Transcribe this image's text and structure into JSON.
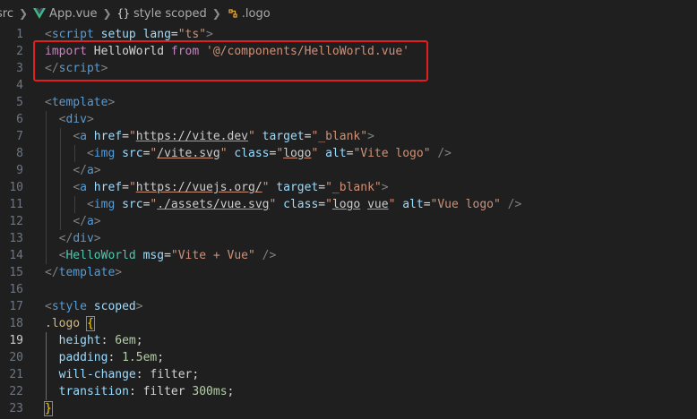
{
  "breadcrumb": {
    "folder": "src",
    "file": "App.vue",
    "section": "style scoped",
    "symbol": ".logo"
  },
  "editor": {
    "active_line": 19,
    "lines": [
      {
        "n": "1",
        "tokens": [
          [
            "tag",
            "<"
          ],
          [
            "tname",
            "script"
          ],
          [
            "attr",
            " setup"
          ],
          [
            "attr",
            " lang"
          ],
          [
            "plain",
            "="
          ],
          [
            "str",
            "\"ts\""
          ],
          [
            "tag",
            ">"
          ]
        ]
      },
      {
        "n": "2",
        "tokens": [
          [
            "kw",
            "import"
          ],
          [
            "plain",
            " HelloWorld "
          ],
          [
            "kw",
            "from"
          ],
          [
            "plain",
            " "
          ],
          [
            "str",
            "'@/components/HelloWorld.vue'"
          ]
        ]
      },
      {
        "n": "3",
        "tokens": [
          [
            "tag",
            "</"
          ],
          [
            "tname",
            "script"
          ],
          [
            "tag",
            ">"
          ]
        ]
      },
      {
        "n": "4",
        "tokens": []
      },
      {
        "n": "5",
        "tokens": [
          [
            "tag",
            "<"
          ],
          [
            "tname",
            "template"
          ],
          [
            "tag",
            ">"
          ]
        ]
      },
      {
        "n": "6",
        "tokens": [
          [
            "plain",
            "  "
          ],
          [
            "tag",
            "<"
          ],
          [
            "tname",
            "div"
          ],
          [
            "tag",
            ">"
          ]
        ]
      },
      {
        "n": "7",
        "tokens": [
          [
            "plain",
            "    "
          ],
          [
            "tag",
            "<"
          ],
          [
            "tname",
            "a"
          ],
          [
            "attr",
            " href"
          ],
          [
            "plain",
            "="
          ],
          [
            "str",
            "\""
          ],
          [
            "ul",
            "https://vite.dev"
          ],
          [
            "str",
            "\""
          ],
          [
            "attr",
            " target"
          ],
          [
            "plain",
            "="
          ],
          [
            "str",
            "\"_blank\""
          ],
          [
            "tag",
            ">"
          ]
        ]
      },
      {
        "n": "8",
        "tokens": [
          [
            "plain",
            "      "
          ],
          [
            "tag",
            "<"
          ],
          [
            "tname",
            "img"
          ],
          [
            "attr",
            " src"
          ],
          [
            "plain",
            "="
          ],
          [
            "str",
            "\""
          ],
          [
            "ul",
            "/vite.svg"
          ],
          [
            "str",
            "\""
          ],
          [
            "attr",
            " class"
          ],
          [
            "plain",
            "="
          ],
          [
            "str",
            "\""
          ],
          [
            "ul",
            "logo"
          ],
          [
            "str",
            "\""
          ],
          [
            "attr",
            " alt"
          ],
          [
            "plain",
            "="
          ],
          [
            "str",
            "\"Vite logo\""
          ],
          [
            "tag",
            " />"
          ]
        ]
      },
      {
        "n": "9",
        "tokens": [
          [
            "plain",
            "    "
          ],
          [
            "tag",
            "</"
          ],
          [
            "tname",
            "a"
          ],
          [
            "tag",
            ">"
          ]
        ]
      },
      {
        "n": "10",
        "tokens": [
          [
            "plain",
            "    "
          ],
          [
            "tag",
            "<"
          ],
          [
            "tname",
            "a"
          ],
          [
            "attr",
            " href"
          ],
          [
            "plain",
            "="
          ],
          [
            "str",
            "\""
          ],
          [
            "ul",
            "https://vuejs.org/"
          ],
          [
            "str",
            "\""
          ],
          [
            "attr",
            " target"
          ],
          [
            "plain",
            "="
          ],
          [
            "str",
            "\"_blank\""
          ],
          [
            "tag",
            ">"
          ]
        ]
      },
      {
        "n": "11",
        "tokens": [
          [
            "plain",
            "      "
          ],
          [
            "tag",
            "<"
          ],
          [
            "tname",
            "img"
          ],
          [
            "attr",
            " src"
          ],
          [
            "plain",
            "="
          ],
          [
            "str",
            "\""
          ],
          [
            "ul",
            "./assets/vue.svg"
          ],
          [
            "str",
            "\""
          ],
          [
            "attr",
            " class"
          ],
          [
            "plain",
            "="
          ],
          [
            "str",
            "\""
          ],
          [
            "ul",
            "logo"
          ],
          [
            "str",
            " "
          ],
          [
            "ul",
            "vue"
          ],
          [
            "str",
            "\""
          ],
          [
            "attr",
            " alt"
          ],
          [
            "plain",
            "="
          ],
          [
            "str",
            "\"Vue logo\""
          ],
          [
            "tag",
            " />"
          ]
        ]
      },
      {
        "n": "12",
        "tokens": [
          [
            "plain",
            "    "
          ],
          [
            "tag",
            "</"
          ],
          [
            "tname",
            "a"
          ],
          [
            "tag",
            ">"
          ]
        ]
      },
      {
        "n": "13",
        "tokens": [
          [
            "plain",
            "  "
          ],
          [
            "tag",
            "</"
          ],
          [
            "tname",
            "div"
          ],
          [
            "tag",
            ">"
          ]
        ]
      },
      {
        "n": "14",
        "tokens": [
          [
            "plain",
            "  "
          ],
          [
            "tag",
            "<"
          ],
          [
            "comp",
            "HelloWorld"
          ],
          [
            "attr",
            " msg"
          ],
          [
            "plain",
            "="
          ],
          [
            "str",
            "\"Vite + Vue\""
          ],
          [
            "tag",
            " />"
          ]
        ]
      },
      {
        "n": "15",
        "tokens": [
          [
            "tag",
            "</"
          ],
          [
            "tname",
            "template"
          ],
          [
            "tag",
            ">"
          ]
        ]
      },
      {
        "n": "16",
        "tokens": []
      },
      {
        "n": "17",
        "tokens": [
          [
            "tag",
            "<"
          ],
          [
            "tname",
            "style"
          ],
          [
            "attr",
            " scoped"
          ],
          [
            "tag",
            ">"
          ]
        ]
      },
      {
        "n": "18",
        "tokens": [
          [
            "sel",
            ".logo"
          ],
          [
            "plain",
            " "
          ],
          [
            "brace",
            "{"
          ]
        ]
      },
      {
        "n": "19",
        "tokens": [
          [
            "plain",
            "  "
          ],
          [
            "prop",
            "height"
          ],
          [
            "plain",
            ": "
          ],
          [
            "num",
            "6em"
          ],
          [
            "plain",
            ";"
          ]
        ]
      },
      {
        "n": "20",
        "tokens": [
          [
            "plain",
            "  "
          ],
          [
            "prop",
            "padding"
          ],
          [
            "plain",
            ": "
          ],
          [
            "num",
            "1.5em"
          ],
          [
            "plain",
            ";"
          ]
        ]
      },
      {
        "n": "21",
        "tokens": [
          [
            "plain",
            "  "
          ],
          [
            "prop",
            "will-change"
          ],
          [
            "plain",
            ": filter;"
          ]
        ]
      },
      {
        "n": "22",
        "tokens": [
          [
            "plain",
            "  "
          ],
          [
            "prop",
            "transition"
          ],
          [
            "plain",
            ": filter "
          ],
          [
            "num",
            "300ms"
          ],
          [
            "plain",
            ";"
          ]
        ]
      },
      {
        "n": "23",
        "tokens": [
          [
            "brace",
            "}"
          ]
        ]
      }
    ]
  }
}
